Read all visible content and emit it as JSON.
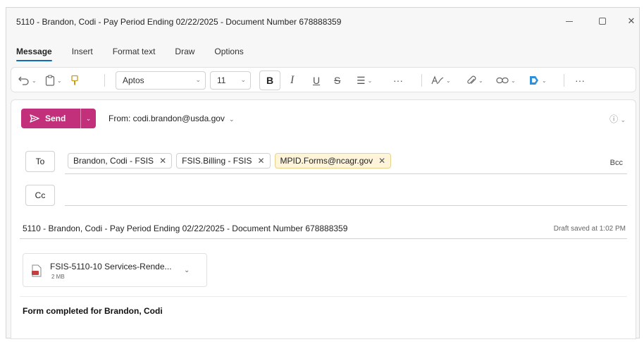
{
  "window": {
    "title": "5110 - Brandon, Codi - Pay Period Ending 02/22/2025 - Document Number 678888359",
    "minimize_label": "—",
    "maximize_label": "□",
    "close_label": "✕"
  },
  "tabs": [
    {
      "label": "Message",
      "active": true
    },
    {
      "label": "Insert"
    },
    {
      "label": "Format text"
    },
    {
      "label": "Draw"
    },
    {
      "label": "Options"
    }
  ],
  "ribbon": {
    "undo_icon": "undo-icon",
    "font_name": "Aptos",
    "font_size": "11",
    "bold_label": "B",
    "italic_label": "I",
    "underline_label": "U",
    "strike_label": "S",
    "more_label": "···"
  },
  "compose": {
    "send_label": "Send",
    "from_text": "From: codi.brandon@usda.gov",
    "to_label": "To",
    "cc_label": "Cc",
    "bcc_label": "Bcc",
    "recipients": [
      "Brandon, Codi - FSIS",
      "FSIS.Billing - FSIS",
      "MPID.Forms@ncagr.gov"
    ],
    "subject": "5110 - Brandon, Codi - Pay Period Ending 02/22/2025 - Document Number 678888359",
    "draft_status": "Draft saved at 1:02 PM",
    "attachment": {
      "name": "FSIS-5110-10 Services-Rende...",
      "size": "2 MB"
    },
    "body": "Form completed for Brandon, Codi"
  },
  "colors": {
    "send": "#c22f7a",
    "external_chip": "#fdf4d9",
    "active_tab_underline": "#0f6cbd"
  }
}
